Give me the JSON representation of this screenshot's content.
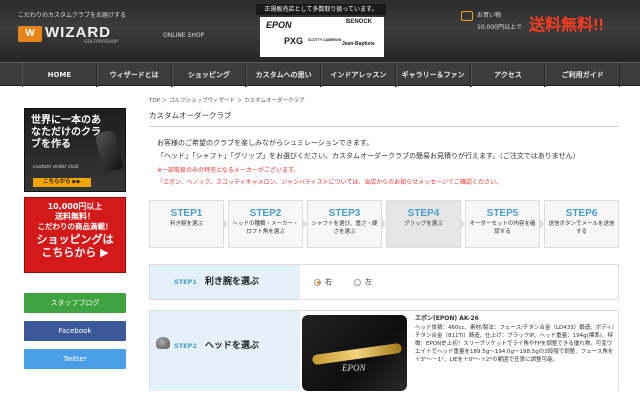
{
  "header": {
    "tagline": "こだわりのカスタムクラブをお届けする",
    "logo_mark": "W",
    "logo_text": "WIZARD",
    "logo_sub": "GOLFPROSHOP",
    "online_shop": "ONLINE SHOP",
    "dealer_title": "正規販売店として多数取り扱っています。",
    "brands": {
      "epon": "EPON",
      "pxg": "PXG",
      "scotty": "SCOTTY CAMERON",
      "benock": "BENOCK",
      "jb": "Jean-Baptiste"
    },
    "cart_label": "お買い物",
    "cart_condition": "10,000円以上で",
    "cart_free": "送料無料!!"
  },
  "nav": {
    "items": [
      "HOME",
      "ウィザードとは",
      "ショッピング",
      "カスタムへの思い",
      "インドアレッスン",
      "ギャラリー＆ファン",
      "アクセス",
      "ご利用ガイド"
    ]
  },
  "sidebar": {
    "promo1": {
      "title": "世界に一本のあなただけのクラブを作る",
      "subtitle": "custom order club",
      "button": "こちらから ▶▶"
    },
    "promo2": {
      "line1": "10,000円以上",
      "line2": "送料無料！",
      "line3": "こだわりの商品満載！",
      "line4": "ショッピングは",
      "line5": "こちらから ▶"
    },
    "buttons": {
      "blog": "スタッフブログ",
      "facebook": "Facebook",
      "twitter": "Twitter"
    }
  },
  "main": {
    "breadcrumb": "TOP ＞ ゴルフショップウィザード ＞ カスタムオーダークラブ",
    "title": "カスタムオーダークラブ",
    "intro1": "お客様のご希望のクラブを楽しみながらシュミレーションできます。",
    "intro2": "「ヘッド」「シャフト」「グリップ」をお選びください。カスタムオーダークラブの簡易お見積りが行えます。（ご注文ではありません）",
    "note1": "※一部取扱のみの特売となるメーカーがございます。",
    "note2": "「エポン、ヘノック、スコッティキャメロン、ジャンバティストについては、当店からのお知らせメッセージでご確認ください。",
    "steps": [
      {
        "num": "STEP1",
        "desc": "利き腕を選ぶ"
      },
      {
        "num": "STEP2",
        "desc": "ヘッドの種類・メーカー・ロフト角を選ぶ"
      },
      {
        "num": "STEP3",
        "desc": "シャフトを選び、重さ・硬さを選ぶ"
      },
      {
        "num": "STEP4",
        "desc": "グリップを選ぶ"
      },
      {
        "num": "STEP5",
        "desc": "オーダーセットの内容を確認する"
      },
      {
        "num": "STEP6",
        "desc": "送信ボタンでメールを送信する"
      }
    ],
    "step1": {
      "no": "STEP1",
      "label": "利き腕を選ぶ",
      "options": [
        "右",
        "左"
      ],
      "selected": "右"
    },
    "step2": {
      "no": "STEP2",
      "label": "ヘッドを選ぶ",
      "product_name": "エポン(EPON) AK-26",
      "product_desc": "ヘッド体積：460cc、素材/製法：フェース/チタン合金（LD433）鍛造、ボディ/チタン合金（811Ti）鋳造、仕上げ：ブラックIP、ヘッド重量：194g(標準)、特徴：EPON史上初！スリーブソケットでライ角やFPを調整できる優れ物。可変ウエイトでヘッド重量を189.5g〜194.0g〜198.5gの3段階で調整、フェース角を＋3°〜－1°、LIEを＋0°〜＋2°の範囲で任意に調整可能。",
      "product_logo": "EPON"
    }
  }
}
